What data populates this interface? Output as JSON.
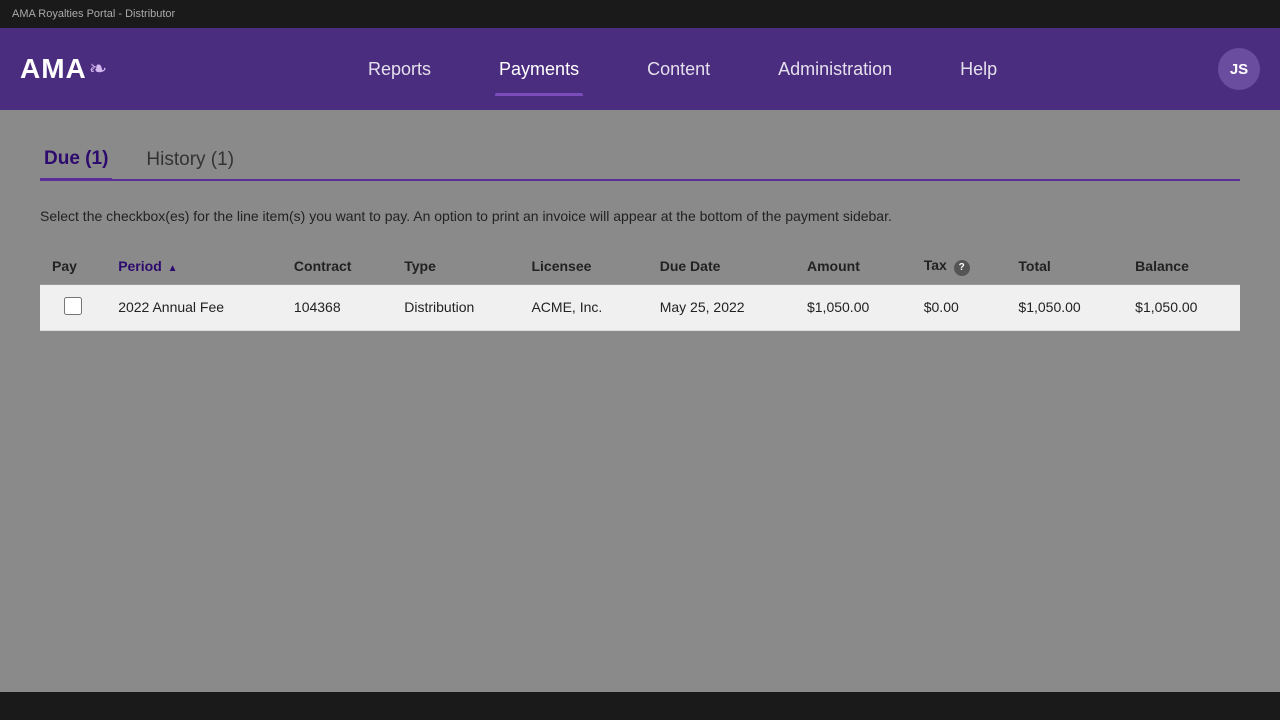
{
  "topBar": {
    "text": "AMA Royalties Portal - Distributor"
  },
  "navbar": {
    "logo": "AMA",
    "logoIconSymbol": "❧",
    "items": [
      {
        "id": "reports",
        "label": "Reports",
        "active": false
      },
      {
        "id": "payments",
        "label": "Payments",
        "active": true
      },
      {
        "id": "content",
        "label": "Content",
        "active": false
      },
      {
        "id": "administration",
        "label": "Administration",
        "active": false
      },
      {
        "id": "help",
        "label": "Help",
        "active": false
      }
    ],
    "userInitials": "JS"
  },
  "tabs": [
    {
      "id": "due",
      "label": "Due (1)",
      "active": true
    },
    {
      "id": "history",
      "label": "History (1)",
      "active": false
    }
  ],
  "instructionText": "Select the checkbox(es) for the line item(s) you want to pay.  An option to print an invoice will appear at the bottom of the payment sidebar.",
  "table": {
    "columns": [
      {
        "id": "pay",
        "label": "Pay",
        "sortable": false
      },
      {
        "id": "period",
        "label": "Period",
        "sortable": true,
        "sortActive": true,
        "sortDir": "asc"
      },
      {
        "id": "contract",
        "label": "Contract",
        "sortable": false
      },
      {
        "id": "type",
        "label": "Type",
        "sortable": false
      },
      {
        "id": "licensee",
        "label": "Licensee",
        "sortable": false
      },
      {
        "id": "due_date",
        "label": "Due Date",
        "sortable": false
      },
      {
        "id": "amount",
        "label": "Amount",
        "sortable": false
      },
      {
        "id": "tax",
        "label": "Tax",
        "sortable": false,
        "hasInfo": true
      },
      {
        "id": "total",
        "label": "Total",
        "sortable": false
      },
      {
        "id": "balance",
        "label": "Balance",
        "sortable": false
      }
    ],
    "rows": [
      {
        "pay": false,
        "period": "2022 Annual Fee",
        "contract": "104368",
        "type": "Distribution",
        "licensee": "ACME, Inc.",
        "due_date": "May 25, 2022",
        "amount": "$1,050.00",
        "tax": "$0.00",
        "total": "$1,050.00",
        "balance": "$1,050.00"
      }
    ]
  }
}
